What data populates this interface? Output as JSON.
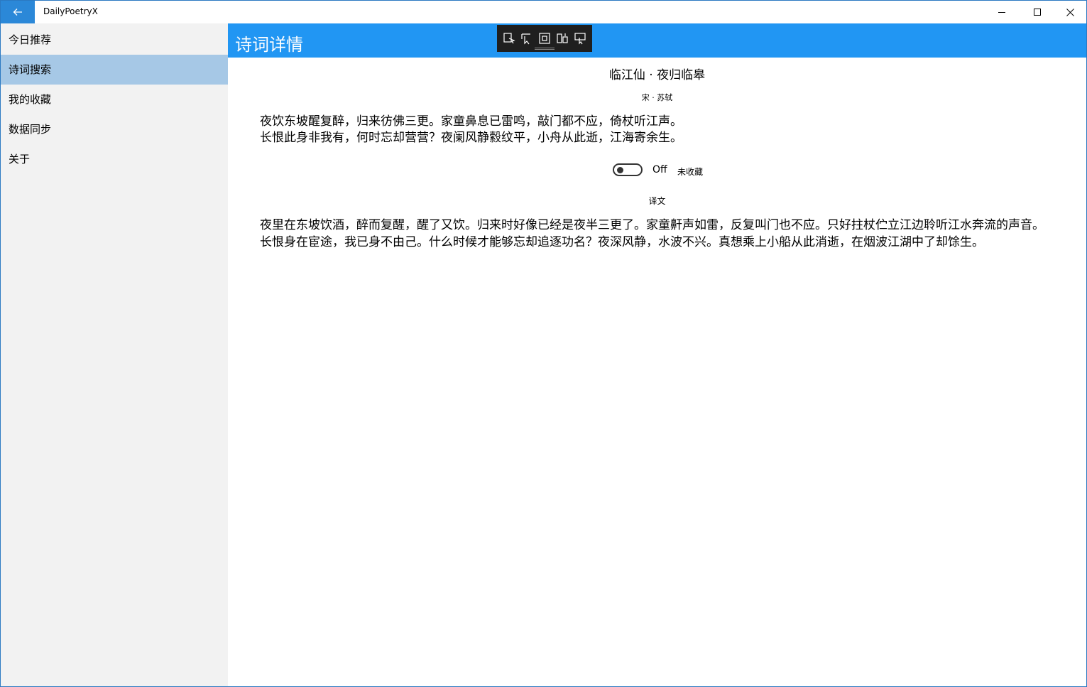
{
  "window": {
    "title": "DailyPoetryX",
    "back_icon": "arrow-left-icon",
    "controls": [
      "minimize-icon",
      "maximize-icon",
      "close-icon"
    ],
    "accent_color": "#2b88d8"
  },
  "sidebar": {
    "background": "#f2f2f2",
    "selected_color": "#a6c8e6",
    "items": [
      {
        "label": "今日推荐"
      },
      {
        "label": "诗词搜索",
        "selected": true
      },
      {
        "label": "我的收藏"
      },
      {
        "label": "数据同步"
      },
      {
        "label": "关于"
      }
    ]
  },
  "header": {
    "title": "诗词详情",
    "color": "#2196f3"
  },
  "debug_toolbar": {
    "icons": [
      "select-element-icon",
      "pointer-select-icon",
      "layout-adorner-icon",
      "track-focus-icon",
      "display-layout-icon"
    ]
  },
  "poem": {
    "title": "临江仙 · 夜归临皋",
    "author": "宋 · 苏轼",
    "lines": [
      "夜饮东坡醒复醉，归来彷佛三更。家童鼻息已雷鸣，敲门都不应，倚杖听江声。",
      "长恨此身非我有，何时忘却营营？夜阑风静縠纹平，小舟从此逝，江海寄余生。"
    ]
  },
  "favorite": {
    "toggle_state": "Off",
    "label": "未收藏",
    "is_on": false
  },
  "translation": {
    "heading": "译文",
    "paragraphs": [
      "夜里在东坡饮酒，醉而复醒，醒了又饮。归来时好像已经是夜半三更了。家童鼾声如雷，反复叫门也不应。只好拄杖伫立江边聆听江水奔流的声音。",
      "长恨身在宦途，我已身不由己。什么时候才能够忘却追逐功名？夜深风静，水波不兴。真想乘上小船从此消逝，在烟波江湖中了却馀生。"
    ]
  }
}
